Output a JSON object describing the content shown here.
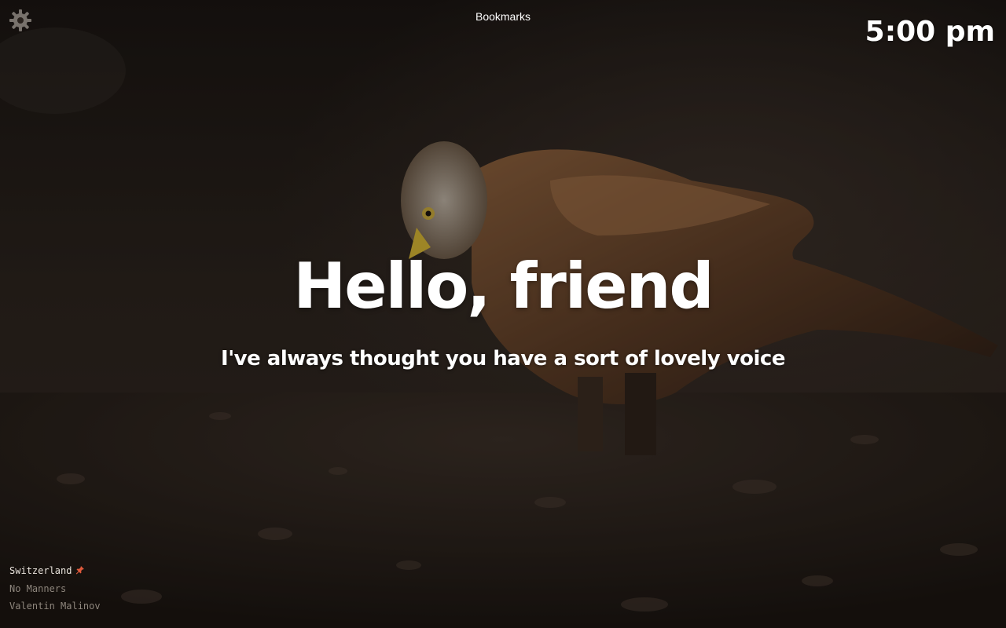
{
  "header": {
    "bookmarks_label": "Bookmarks",
    "clock": "5:00 pm",
    "settings_icon": "gear-icon"
  },
  "main": {
    "greeting": "Hello, friend",
    "message": "I've always thought you have a sort of lovely voice"
  },
  "credits": {
    "location": "Switzerland",
    "pin_icon": "pin-icon",
    "title": "No Manners",
    "author": "Valentin Malinov"
  },
  "colors": {
    "text": "#ffffff",
    "pin": "#e05a3c",
    "background": "#1c1612"
  }
}
